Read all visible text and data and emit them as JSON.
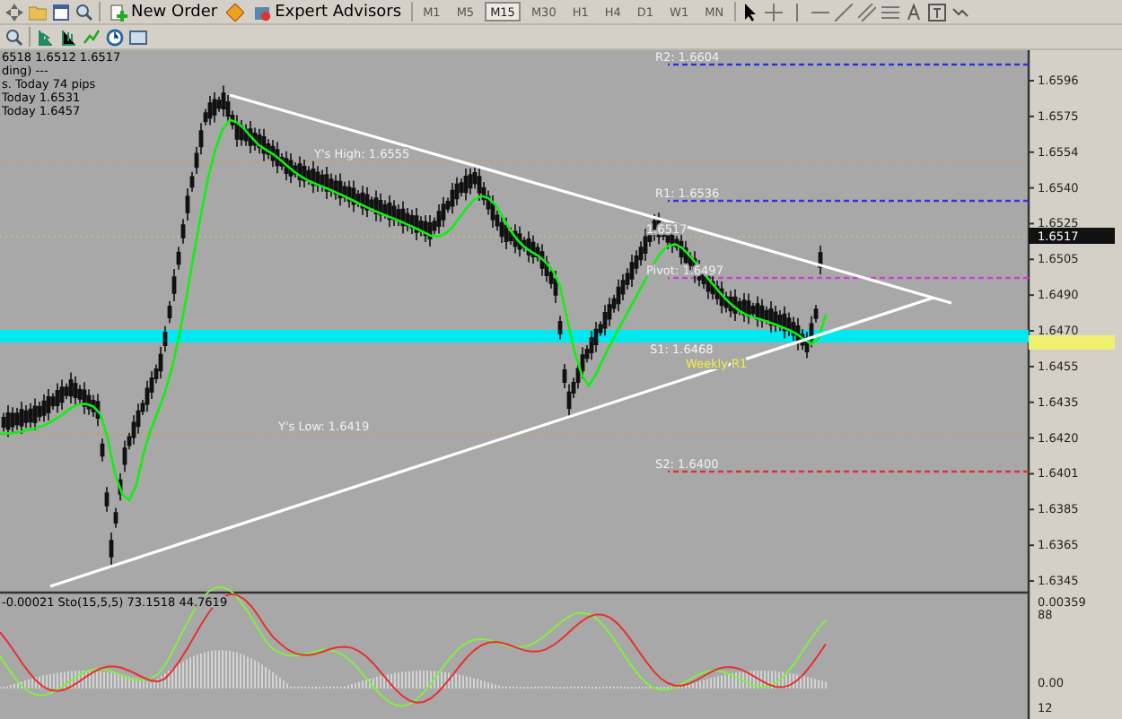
{
  "toolbar": {
    "buttons": [
      {
        "label": "New Order"
      },
      {
        "label": "Expert Advisors"
      }
    ],
    "timeframes": [
      {
        "label": "M1",
        "selected": false
      },
      {
        "label": "M5",
        "selected": false
      },
      {
        "label": "M15",
        "selected": true
      },
      {
        "label": "M30",
        "selected": false
      },
      {
        "label": "H1",
        "selected": false
      },
      {
        "label": "H4",
        "selected": false
      },
      {
        "label": "D1",
        "selected": false
      },
      {
        "label": "W1",
        "selected": false
      },
      {
        "label": "MN",
        "selected": false
      }
    ]
  },
  "chart": {
    "info_lines": [
      "6518 1.6512 1.6517",
      "ding) ---",
      "s. Today 74 pips",
      "Today 1.6531",
      "Today 1.6457"
    ],
    "levels": [
      {
        "label": "R2: 1.6604",
        "color": "#3030e0"
      },
      {
        "label": "Y's High: 1.6555",
        "color": "#c8a060"
      },
      {
        "label": "R1: 1.6536",
        "color": "#3030e0"
      },
      {
        "label": "1.6517",
        "color": "#c8b090"
      },
      {
        "label": "Pivot: 1.6497",
        "color": "#d040d0"
      },
      {
        "label": "S1: 1.6468",
        "color": "#00e8f0"
      },
      {
        "label": "Y's Low: 1.6419",
        "color": "#c8a060"
      },
      {
        "label": "S2: 1.6400",
        "color": "#e03030"
      }
    ],
    "weekly_label": "Weekly R1",
    "current_price": "1.6517",
    "price_axis": [
      "1.6596",
      "1.6575",
      "1.6554",
      "1.6540",
      "1.6525",
      "1.6505",
      "1.6490",
      "1.6470",
      "1.6455",
      "1.6435",
      "1.6420",
      "1.6401",
      "1.6385",
      "1.6365",
      "1.6345"
    ]
  },
  "indicator": {
    "legend": "-0.00021  Sto(15,5,5) 73.1518 44.7619",
    "axis": [
      "0.00359",
      "88",
      "0.00",
      "12"
    ]
  }
}
